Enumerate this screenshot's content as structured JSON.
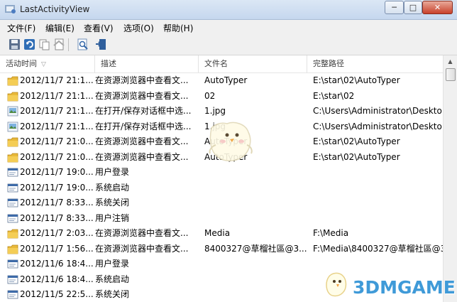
{
  "window": {
    "title": "LastActivityView",
    "minimize_glyph": "─",
    "maximize_glyph": "□",
    "close_glyph": "✕"
  },
  "menu": {
    "items": [
      "文件(F)",
      "编辑(E)",
      "查看(V)",
      "选项(O)",
      "帮助(H)"
    ]
  },
  "toolbar": {
    "buttons": [
      "save-icon",
      "refresh-icon",
      "copy-icon",
      "html-report-icon",
      "properties-icon",
      "exit-icon"
    ]
  },
  "table": {
    "columns": [
      "活动时间",
      "描述",
      "文件名",
      "完整路径"
    ],
    "sort_indicator": "▽",
    "rows": [
      {
        "icon": "folder-icon",
        "time": "2012/11/7 21:1...",
        "desc": "在资源浏览器中查看文...",
        "file": "AutoTyper",
        "path": "E:\\star\\02\\AutoTyper"
      },
      {
        "icon": "folder-icon",
        "time": "2012/11/7 21:1...",
        "desc": "在资源浏览器中查看文...",
        "file": "02",
        "path": "E:\\star\\02"
      },
      {
        "icon": "image-file-icon",
        "time": "2012/11/7 21:1...",
        "desc": "在打开/保存对话框中选...",
        "file": "1.jpg",
        "path": "C:\\Users\\Administrator\\Deskto"
      },
      {
        "icon": "image-file-icon",
        "time": "2012/11/7 21:1...",
        "desc": "在打开/保存对话框中选...",
        "file": "1.jpg",
        "path": "C:\\Users\\Administrator\\Deskto"
      },
      {
        "icon": "folder-icon",
        "time": "2012/11/7 21:0...",
        "desc": "在资源浏览器中查看文...",
        "file": "AutoTyper",
        "path": "E:\\star\\02\\AutoTyper"
      },
      {
        "icon": "folder-icon",
        "time": "2012/11/7 21:0...",
        "desc": "在资源浏览器中查看文...",
        "file": "AutoTyper",
        "path": "E:\\star\\02\\AutoTyper"
      },
      {
        "icon": "system-event-icon",
        "time": "2012/11/7 19:0...",
        "desc": "用户登录",
        "file": "",
        "path": ""
      },
      {
        "icon": "system-event-icon",
        "time": "2012/11/7 19:0...",
        "desc": "系统启动",
        "file": "",
        "path": ""
      },
      {
        "icon": "system-event-icon",
        "time": "2012/11/7 8:33...",
        "desc": "系统关闭",
        "file": "",
        "path": ""
      },
      {
        "icon": "system-event-icon",
        "time": "2012/11/7 8:33...",
        "desc": "用户注销",
        "file": "",
        "path": ""
      },
      {
        "icon": "folder-icon",
        "time": "2012/11/7 2:03...",
        "desc": "在资源浏览器中查看文...",
        "file": "Media",
        "path": "F:\\Media"
      },
      {
        "icon": "folder-icon",
        "time": "2012/11/7 1:56...",
        "desc": "在资源浏览器中查看文...",
        "file": "8400327@草榴社區@3...",
        "path": "F:\\Media\\8400327@草榴社區@3"
      },
      {
        "icon": "system-event-icon",
        "time": "2012/11/6 18:4...",
        "desc": "用户登录",
        "file": "",
        "path": ""
      },
      {
        "icon": "system-event-icon",
        "time": "2012/11/6 18:4...",
        "desc": "系统启动",
        "file": "",
        "path": ""
      },
      {
        "icon": "system-event-icon",
        "time": "2012/11/5 22:5...",
        "desc": "系统关闭",
        "file": "",
        "path": ""
      }
    ]
  },
  "scrollbar": {
    "up_glyph": "▲"
  },
  "watermark": {
    "text": "3DMGAME"
  },
  "colors": {
    "folder": "#e8b93a",
    "watermark": "#3f9ad8",
    "selection_header": "#ffffff"
  }
}
